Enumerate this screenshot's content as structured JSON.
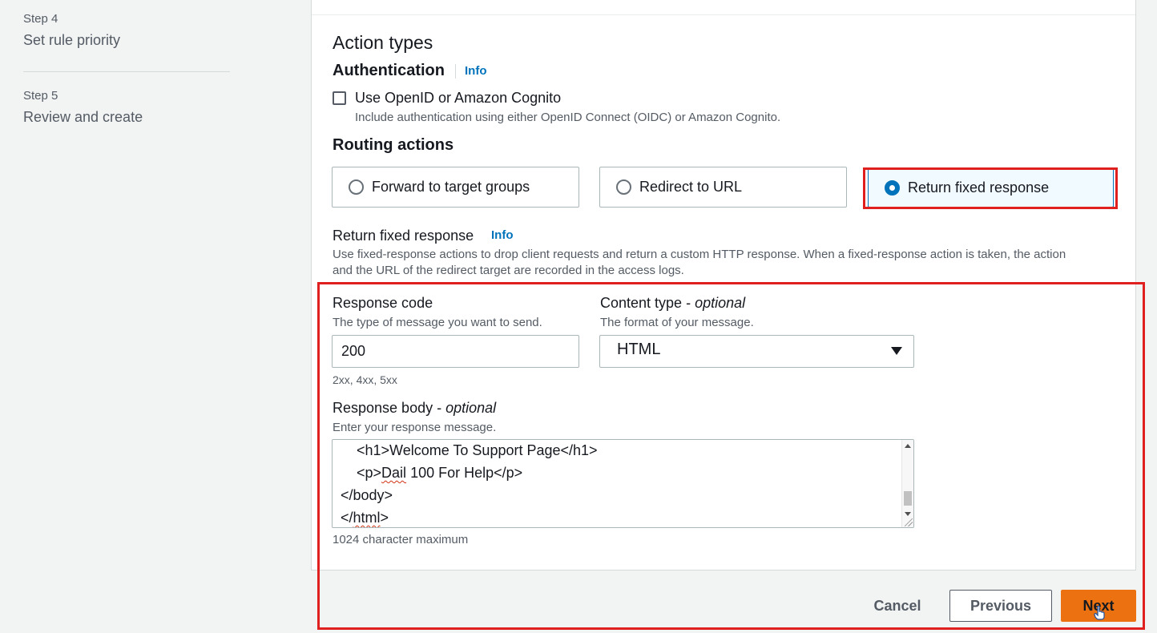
{
  "sidebar": {
    "steps": [
      {
        "number": "Step 4",
        "title": "Set rule priority"
      },
      {
        "number": "Step 5",
        "title": "Review and create"
      }
    ]
  },
  "main": {
    "action_types_title": "Action types",
    "authentication": {
      "title": "Authentication",
      "info": "Info",
      "checkbox_label": "Use OpenID or Amazon Cognito",
      "checkbox_checked": false,
      "checkbox_desc": "Include authentication using either OpenID Connect (OIDC) or Amazon Cognito."
    },
    "routing": {
      "title": "Routing actions",
      "options": [
        {
          "label": "Forward to target groups",
          "selected": false
        },
        {
          "label": "Redirect to URL",
          "selected": false
        },
        {
          "label": "Return fixed response",
          "selected": true
        }
      ]
    },
    "fixed_response": {
      "title": "Return fixed response",
      "info": "Info",
      "desc_line1": "Use fixed-response actions to drop client requests and return a custom HTTP response. When a fixed-response action is taken, the action",
      "desc_line2": "and the URL of the redirect target are recorded in the access logs.",
      "response_code": {
        "label": "Response code",
        "desc": "The type of message you want to send.",
        "value": "200",
        "hint": "2xx, 4xx, 5xx"
      },
      "content_type": {
        "label": "Content type",
        "optional": "optional",
        "desc": "The format of your message.",
        "value": "HTML"
      },
      "response_body": {
        "label": "Response body",
        "optional": "optional",
        "desc": "Enter your response message.",
        "lines": [
          "    <h1>Welcome To Support Page</h1>",
          "    <p>Dail 100 For Help</p>",
          "</body>",
          "</html>"
        ],
        "hint": "1024 character maximum"
      }
    }
  },
  "footer": {
    "cancel": "Cancel",
    "previous": "Previous",
    "next": "Next"
  },
  "colors": {
    "accent": "#0073bb",
    "primary_button": "#ec7211",
    "highlight_box": "#e0201f"
  }
}
